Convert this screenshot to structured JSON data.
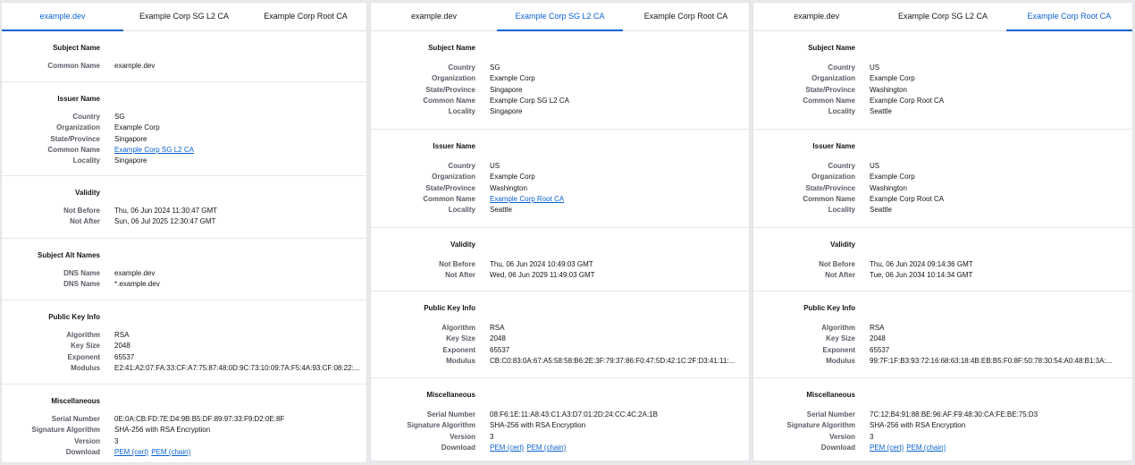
{
  "panels": [
    {
      "tabs": [
        "example.dev",
        "Example Corp SG L2 CA",
        "Example Corp Root CA"
      ],
      "active_tab": 0,
      "sections": [
        {
          "title": "Subject Name",
          "rows": [
            {
              "label": "Common Name",
              "value": "example.dev"
            }
          ]
        },
        {
          "title": "Issuer Name",
          "rows": [
            {
              "label": "Country",
              "value": "SG"
            },
            {
              "label": "Organization",
              "value": "Example Corp"
            },
            {
              "label": "State/Province",
              "value": "Singapore"
            },
            {
              "label": "Common Name",
              "value": "Example Corp SG L2 CA",
              "link": true
            },
            {
              "label": "Locality",
              "value": "Singapore"
            }
          ]
        },
        {
          "title": "Validity",
          "rows": [
            {
              "label": "Not Before",
              "value": "Thu, 06 Jun 2024 11:30:47 GMT"
            },
            {
              "label": "Not After",
              "value": "Sun, 06 Jul 2025 12:30:47 GMT"
            }
          ]
        },
        {
          "title": "Subject Alt Names",
          "rows": [
            {
              "label": "DNS Name",
              "value": "example.dev"
            },
            {
              "label": "DNS Name",
              "value": "*.example.dev"
            }
          ]
        },
        {
          "title": "Public Key Info",
          "rows": [
            {
              "label": "Algorithm",
              "value": "RSA"
            },
            {
              "label": "Key Size",
              "value": "2048"
            },
            {
              "label": "Exponent",
              "value": "65537"
            },
            {
              "label": "Modulus",
              "value": "E2:41:A2:07:FA:33:CF:A7:75:87:48:0D:9C:73:10:09:7A:F5:4A:93:CF:08:22:..."
            }
          ]
        },
        {
          "title": "Miscellaneous",
          "rows": [
            {
              "label": "Serial Number",
              "value": "0E:0A:CB:FD:7E:D4:9B:B5:DF:89:97:33:F9:D2:0E:8F"
            },
            {
              "label": "Signature Algorithm",
              "value": "SHA-256 with RSA Encryption"
            },
            {
              "label": "Version",
              "value": "3"
            },
            {
              "label": "Download",
              "links": [
                "PEM (cert)",
                "PEM (chain)"
              ]
            }
          ]
        }
      ]
    },
    {
      "tabs": [
        "example.dev",
        "Example Corp SG L2 CA",
        "Example Corp Root CA"
      ],
      "active_tab": 1,
      "sections": [
        {
          "title": "Subject Name",
          "rows": [
            {
              "label": "Country",
              "value": "SG"
            },
            {
              "label": "Organization",
              "value": "Example Corp"
            },
            {
              "label": "State/Province",
              "value": "Singapore"
            },
            {
              "label": "Common Name",
              "value": "Example Corp SG L2 CA"
            },
            {
              "label": "Locality",
              "value": "Singapore"
            }
          ]
        },
        {
          "title": "Issuer Name",
          "rows": [
            {
              "label": "Country",
              "value": "US"
            },
            {
              "label": "Organization",
              "value": "Example Corp"
            },
            {
              "label": "State/Province",
              "value": "Washington"
            },
            {
              "label": "Common Name",
              "value": "Example Corp Root CA",
              "link": true
            },
            {
              "label": "Locality",
              "value": "Seattle"
            }
          ]
        },
        {
          "title": "Validity",
          "rows": [
            {
              "label": "Not Before",
              "value": "Thu, 06 Jun 2024 10:49:03 GMT"
            },
            {
              "label": "Not After",
              "value": "Wed, 06 Jun 2029 11:49:03 GMT"
            }
          ]
        },
        {
          "title": "Public Key Info",
          "rows": [
            {
              "label": "Algorithm",
              "value": "RSA"
            },
            {
              "label": "Key Size",
              "value": "2048"
            },
            {
              "label": "Exponent",
              "value": "65537"
            },
            {
              "label": "Modulus",
              "value": "CB:C0:83:0A:67:A5:58:58:B6:2E:3F:79:37:86:F0:47:5D:42:1C:2F:D3:41:11:..."
            }
          ]
        },
        {
          "title": "Miscellaneous",
          "rows": [
            {
              "label": "Serial Number",
              "value": "08:F6:1E:11:A8:43:C1:A3:D7:01:2D:24:CC:4C:2A:1B"
            },
            {
              "label": "Signature Algorithm",
              "value": "SHA-256 with RSA Encryption"
            },
            {
              "label": "Version",
              "value": "3"
            },
            {
              "label": "Download",
              "links": [
                "PEM (cert)",
                "PEM (chain)"
              ]
            }
          ]
        }
      ]
    },
    {
      "tabs": [
        "example.dev",
        "Example Corp SG L2 CA",
        "Example Corp Root CA"
      ],
      "active_tab": 2,
      "sections": [
        {
          "title": "Subject Name",
          "rows": [
            {
              "label": "Country",
              "value": "US"
            },
            {
              "label": "Organization",
              "value": "Example Corp"
            },
            {
              "label": "State/Province",
              "value": "Washington"
            },
            {
              "label": "Common Name",
              "value": "Example Corp Root CA"
            },
            {
              "label": "Locality",
              "value": "Seattle"
            }
          ]
        },
        {
          "title": "Issuer Name",
          "rows": [
            {
              "label": "Country",
              "value": "US"
            },
            {
              "label": "Organization",
              "value": "Example Corp"
            },
            {
              "label": "State/Province",
              "value": "Washington"
            },
            {
              "label": "Common Name",
              "value": "Example Corp Root CA"
            },
            {
              "label": "Locality",
              "value": "Seattle"
            }
          ]
        },
        {
          "title": "Validity",
          "rows": [
            {
              "label": "Not Before",
              "value": "Thu, 06 Jun 2024 09:14:36 GMT"
            },
            {
              "label": "Not After",
              "value": "Tue, 06 Jun 2034 10:14:34 GMT"
            }
          ]
        },
        {
          "title": "Public Key Info",
          "rows": [
            {
              "label": "Algorithm",
              "value": "RSA"
            },
            {
              "label": "Key Size",
              "value": "2048"
            },
            {
              "label": "Exponent",
              "value": "65537"
            },
            {
              "label": "Modulus",
              "value": "99:7F:1F:B3:93:72:16:68:63:18:4B:EB:B5:F0:8F:50:78:30:54:A0:48:B1:3A:..."
            }
          ]
        },
        {
          "title": "Miscellaneous",
          "rows": [
            {
              "label": "Serial Number",
              "value": "7C:12:B4:91:88:BE:96:AF:F9:48:30:CA:FE:BE:75:D3"
            },
            {
              "label": "Signature Algorithm",
              "value": "SHA-256 with RSA Encryption"
            },
            {
              "label": "Version",
              "value": "3"
            },
            {
              "label": "Download",
              "links": [
                "PEM (cert)",
                "PEM (chain)"
              ]
            }
          ]
        }
      ]
    }
  ]
}
